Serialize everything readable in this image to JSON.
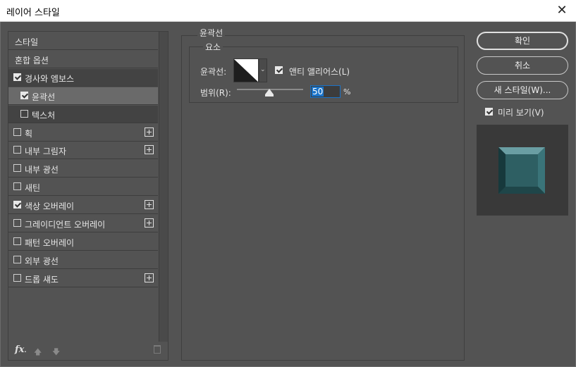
{
  "window": {
    "title": "레이어 스타일",
    "close_glyph": "✕"
  },
  "styles_list": [
    {
      "label": "스타일",
      "checkbox": false,
      "checked": false,
      "plus": false,
      "indent": false
    },
    {
      "label": "혼합 옵션",
      "checkbox": false,
      "checked": false,
      "plus": false,
      "indent": false
    },
    {
      "label": "경사와 엠보스",
      "checkbox": true,
      "checked": true,
      "plus": false,
      "indent": false
    },
    {
      "label": "윤곽선",
      "checkbox": true,
      "checked": true,
      "plus": false,
      "indent": true,
      "selected": true
    },
    {
      "label": "텍스처",
      "checkbox": true,
      "checked": false,
      "plus": false,
      "indent": true
    },
    {
      "label": "획",
      "checkbox": true,
      "checked": false,
      "plus": true,
      "indent": false
    },
    {
      "label": "내부 그림자",
      "checkbox": true,
      "checked": false,
      "plus": true,
      "indent": false
    },
    {
      "label": "내부 광선",
      "checkbox": true,
      "checked": false,
      "plus": false,
      "indent": false
    },
    {
      "label": "새틴",
      "checkbox": true,
      "checked": false,
      "plus": false,
      "indent": false
    },
    {
      "label": "색상 오버레이",
      "checkbox": true,
      "checked": true,
      "plus": true,
      "indent": false
    },
    {
      "label": "그레이디언트 오버레이",
      "checkbox": true,
      "checked": false,
      "plus": true,
      "indent": false
    },
    {
      "label": "패턴 오버레이",
      "checkbox": true,
      "checked": false,
      "plus": false,
      "indent": false
    },
    {
      "label": "외부 광선",
      "checkbox": true,
      "checked": false,
      "plus": false,
      "indent": false
    },
    {
      "label": "드롭 섀도",
      "checkbox": true,
      "checked": false,
      "plus": true,
      "indent": false
    }
  ],
  "bottom_bar": {
    "fx_label": "fx",
    "fx_dot": ".",
    "move_up_glyph": "🡅",
    "move_down_glyph": "🡇"
  },
  "contour_panel": {
    "section_title": "윤곽선",
    "group_title": "요소",
    "contour_label": "윤곽선:",
    "dropdown_glyph": "⌄",
    "anti_alias_label": "앤티 앨리어스(L)",
    "anti_alias_checked": true,
    "range_label": "범위(R):",
    "range_value": "50",
    "range_percent": 50,
    "range_unit": "%"
  },
  "buttons": {
    "ok": "확인",
    "cancel": "취소",
    "new_style": "새 스타일(W)..."
  },
  "preview": {
    "label": "미리 보기(V)",
    "checked": true
  },
  "colors": {
    "panel": "#535353",
    "dark_row": "#434343",
    "selected_row": "#6a6a6a",
    "accent": "#1a73c8",
    "preview_teal": "#2e5f63"
  }
}
